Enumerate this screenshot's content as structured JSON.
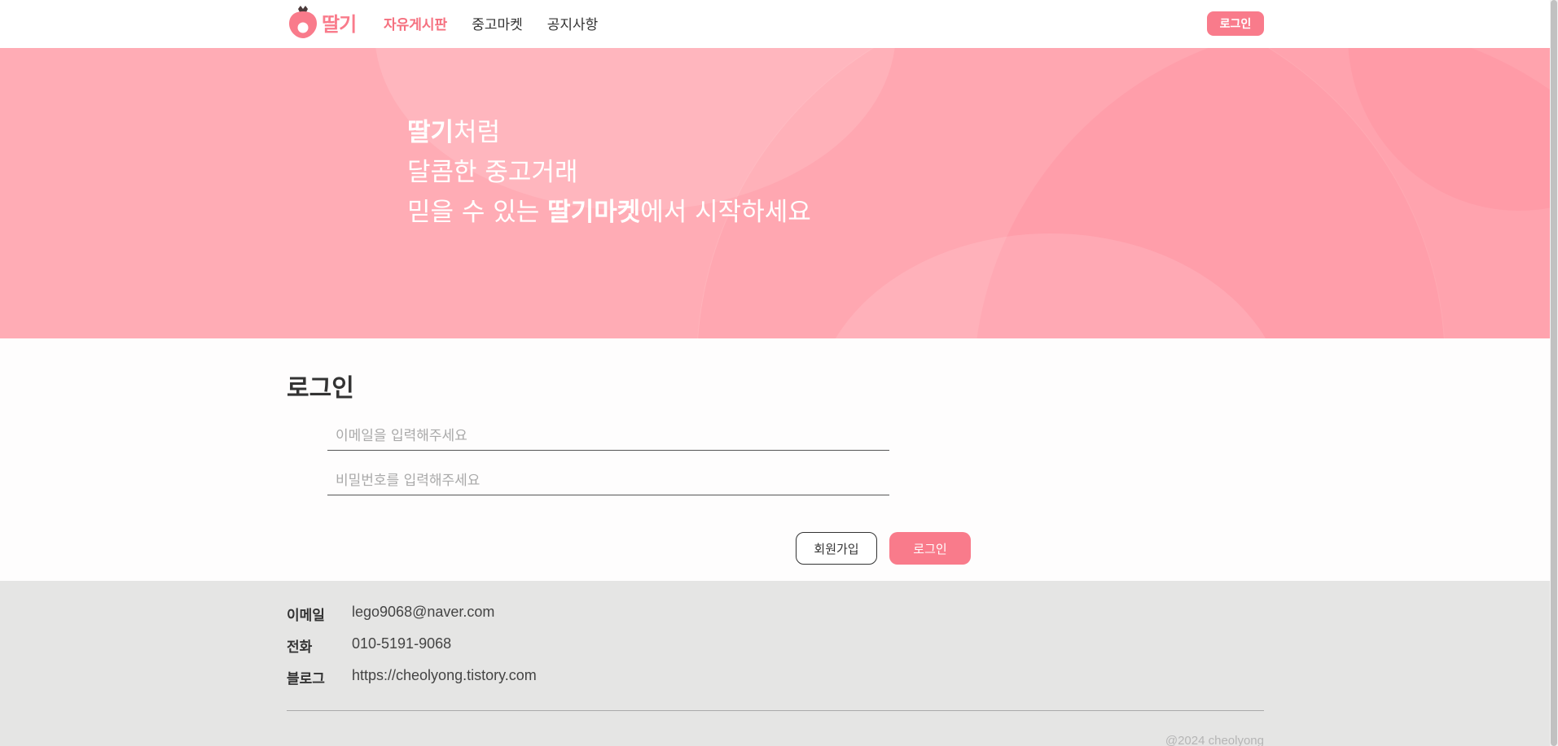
{
  "header": {
    "logo_text": "딸기",
    "nav": [
      {
        "label": "자유게시판",
        "active": true
      },
      {
        "label": "중고마켓",
        "active": false
      },
      {
        "label": "공지사항",
        "active": false
      }
    ],
    "login_button": "로그인"
  },
  "hero": {
    "line1_bold": "딸기",
    "line1_rest": "처럼",
    "line2": "달콤한 중고거래",
    "line3_pre": "믿을 수 있는 ",
    "line3_bold": "딸기마켓",
    "line3_post": "에서 시작하세요"
  },
  "login": {
    "title": "로그인",
    "email_placeholder": "이메일을 입력해주세요",
    "password_placeholder": "비밀번호를 입력해주세요",
    "signup_button": "회원가입",
    "login_button": "로그인"
  },
  "footer": {
    "rows": [
      {
        "label": "이메일",
        "value": "lego9068@naver.com"
      },
      {
        "label": "전화",
        "value": "010-5191-9068"
      },
      {
        "label": "블로그",
        "value": "https://cheolyong.tistory.com"
      }
    ],
    "copyright": "@2024 cheolyong"
  },
  "colors": {
    "accent": "#f97b8b",
    "hero_bg": "#ffacb5",
    "footer_bg": "#e5e5e4"
  },
  "icons": {
    "logo": "strawberry-icon"
  }
}
